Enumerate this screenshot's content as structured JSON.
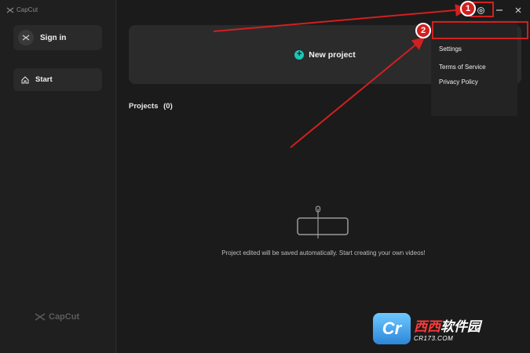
{
  "app": {
    "title": "CapCut"
  },
  "sidebar": {
    "signin_label": "Sign in",
    "start_label": "Start",
    "footer_logo": "CapCut"
  },
  "main": {
    "new_project_label": "New project",
    "projects_label": "Projects",
    "projects_count": "(0)",
    "empty_message": "Project edited will be saved automatically. Start creating your own videos!"
  },
  "menu": {
    "items": [
      "Settings",
      "Terms of Service",
      "Privacy Policy"
    ]
  },
  "annotations": {
    "badge_1": "1",
    "badge_2": "2",
    "color": "#d31f1f"
  },
  "watermark": {
    "logo": "Cr",
    "brand_highlight": "西西",
    "brand_rest": "软件园",
    "site": "CR173.COM"
  },
  "colors": {
    "accent": "#1fc6b5",
    "background": "#1b1b1b",
    "sidebar": "#1f1f1f",
    "card": "#2b2b2b"
  }
}
